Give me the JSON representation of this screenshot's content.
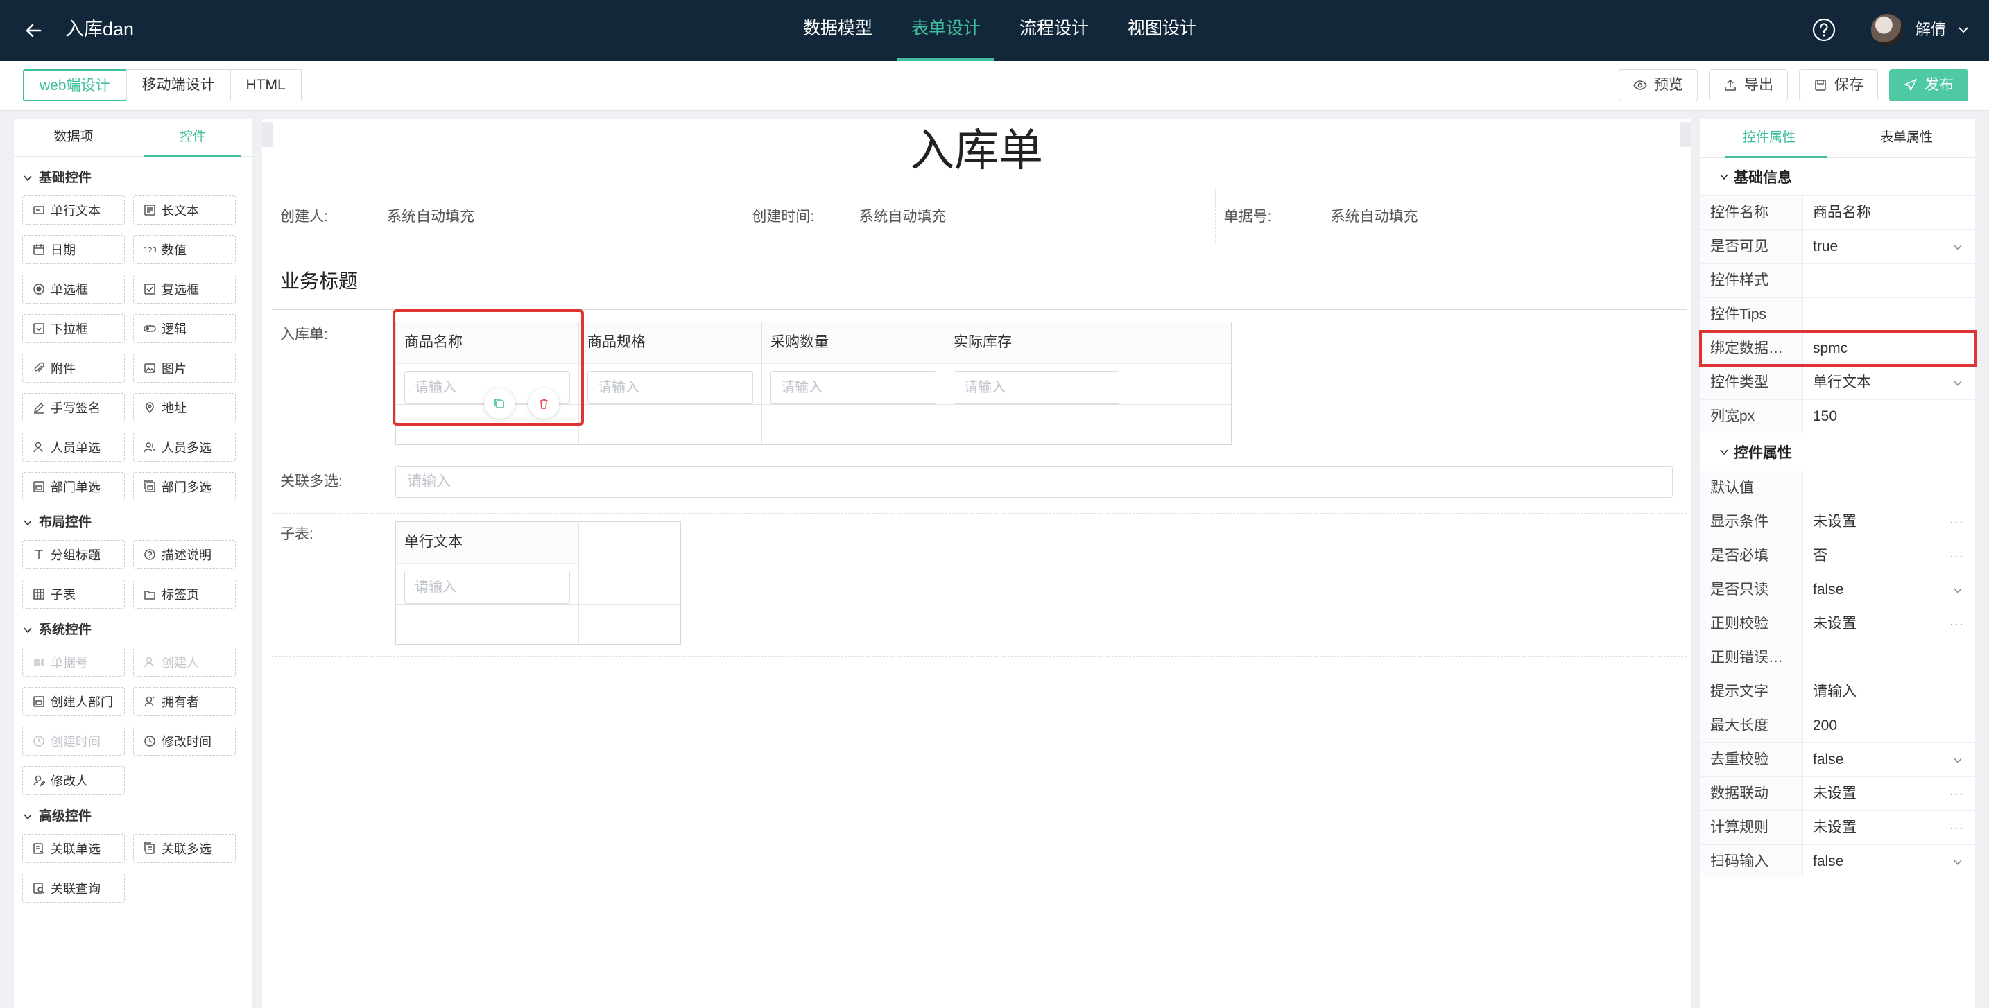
{
  "header": {
    "title": "入库dan",
    "nav": [
      "数据模型",
      "表单设计",
      "流程设计",
      "视图设计"
    ],
    "active_nav": 1,
    "user_name": "解倩"
  },
  "toolbar": {
    "modes": [
      "web端设计",
      "移动端设计",
      "HTML"
    ],
    "actions": {
      "preview": "预览",
      "export": "导出",
      "save": "保存",
      "publish": "发布"
    }
  },
  "left_panel": {
    "tabs": [
      "数据项",
      "控件"
    ],
    "groups": [
      {
        "title": "基础控件",
        "items": [
          {
            "label": "单行文本",
            "icon": "text-icon"
          },
          {
            "label": "长文本",
            "icon": "textarea-icon"
          },
          {
            "label": "日期",
            "icon": "calendar-icon"
          },
          {
            "label": "数值",
            "icon": "number-icon"
          },
          {
            "label": "单选框",
            "icon": "radio-icon"
          },
          {
            "label": "复选框",
            "icon": "checkbox-icon"
          },
          {
            "label": "下拉框",
            "icon": "dropdown-icon"
          },
          {
            "label": "逻辑",
            "icon": "toggle-icon"
          },
          {
            "label": "附件",
            "icon": "paperclip-icon"
          },
          {
            "label": "图片",
            "icon": "image-icon"
          },
          {
            "label": "手写签名",
            "icon": "pen-icon"
          },
          {
            "label": "地址",
            "icon": "location-icon"
          },
          {
            "label": "人员单选",
            "icon": "user-icon"
          },
          {
            "label": "人员多选",
            "icon": "users-icon"
          },
          {
            "label": "部门单选",
            "icon": "dept-icon"
          },
          {
            "label": "部门多选",
            "icon": "dept-multi-icon"
          }
        ]
      },
      {
        "title": "布局控件",
        "items": [
          {
            "label": "分组标题",
            "icon": "heading-icon"
          },
          {
            "label": "描述说明",
            "icon": "help-circle-icon"
          },
          {
            "label": "子表",
            "icon": "table-icon"
          },
          {
            "label": "标签页",
            "icon": "tabs-icon"
          }
        ]
      },
      {
        "title": "系统控件",
        "items": [
          {
            "label": "单据号",
            "icon": "barcode-icon",
            "disabled": true
          },
          {
            "label": "创建人",
            "icon": "user-icon",
            "disabled": true
          },
          {
            "label": "创建人部门",
            "icon": "dept-icon"
          },
          {
            "label": "拥有者",
            "icon": "owner-icon"
          },
          {
            "label": "创建时间",
            "icon": "clock-icon",
            "disabled": true
          },
          {
            "label": "修改时间",
            "icon": "clock-edit-icon"
          },
          {
            "label": "修改人",
            "icon": "user-edit-icon"
          }
        ]
      },
      {
        "title": "高级控件",
        "items": [
          {
            "label": "关联单选",
            "icon": "link-form-icon"
          },
          {
            "label": "关联多选",
            "icon": "link-forms-icon"
          },
          {
            "label": "关联查询",
            "icon": "link-search-icon"
          }
        ]
      }
    ]
  },
  "canvas": {
    "title": "入库单",
    "sys_fields": [
      {
        "label": "创建人:",
        "value": "系统自动填充"
      },
      {
        "label": "创建时间:",
        "value": "系统自动填充"
      },
      {
        "label": "单据号:",
        "value": "系统自动填充"
      }
    ],
    "section_title": "业务标题",
    "subtable1": {
      "label": "入库单:",
      "columns": [
        "商品名称",
        "商品规格",
        "采购数量",
        "实际库存"
      ],
      "placeholder": "请输入"
    },
    "relation_field": {
      "label": "关联多选:",
      "placeholder": "请输入"
    },
    "subtable2": {
      "label": "子表:",
      "columns": [
        "单行文本"
      ],
      "placeholder": "请输入"
    }
  },
  "right_panel": {
    "tabs": [
      "控件属性",
      "表单属性"
    ],
    "sections": [
      {
        "title": "基础信息",
        "props": [
          {
            "label": "控件名称",
            "value": "商品名称"
          },
          {
            "label": "是否可见",
            "value": "true",
            "type": "select"
          },
          {
            "label": "控件样式",
            "value": ""
          },
          {
            "label": "控件Tips",
            "value": ""
          },
          {
            "label": "绑定数据…",
            "value": "spmc",
            "highlight": true
          },
          {
            "label": "控件类型",
            "value": "单行文本",
            "type": "select"
          },
          {
            "label": "列宽px",
            "value": "150"
          }
        ]
      },
      {
        "title": "控件属性",
        "props": [
          {
            "label": "默认值",
            "value": ""
          },
          {
            "label": "显示条件",
            "value": "未设置",
            "type": "more"
          },
          {
            "label": "是否必填",
            "value": "否",
            "type": "more"
          },
          {
            "label": "是否只读",
            "value": "false",
            "type": "select"
          },
          {
            "label": "正则校验",
            "value": "未设置",
            "type": "more"
          },
          {
            "label": "正则错误…",
            "value": ""
          },
          {
            "label": "提示文字",
            "value": "请输入"
          },
          {
            "label": "最大长度",
            "value": "200"
          },
          {
            "label": "去重校验",
            "value": "false",
            "type": "select"
          },
          {
            "label": "数据联动",
            "value": "未设置",
            "type": "more"
          },
          {
            "label": "计算规则",
            "value": "未设置",
            "type": "more"
          },
          {
            "label": "扫码输入",
            "value": "false",
            "type": "select"
          }
        ]
      }
    ]
  },
  "colors": {
    "topbar": "#12283a",
    "accent": "#3fbf9e",
    "highlight": "#e03333"
  }
}
